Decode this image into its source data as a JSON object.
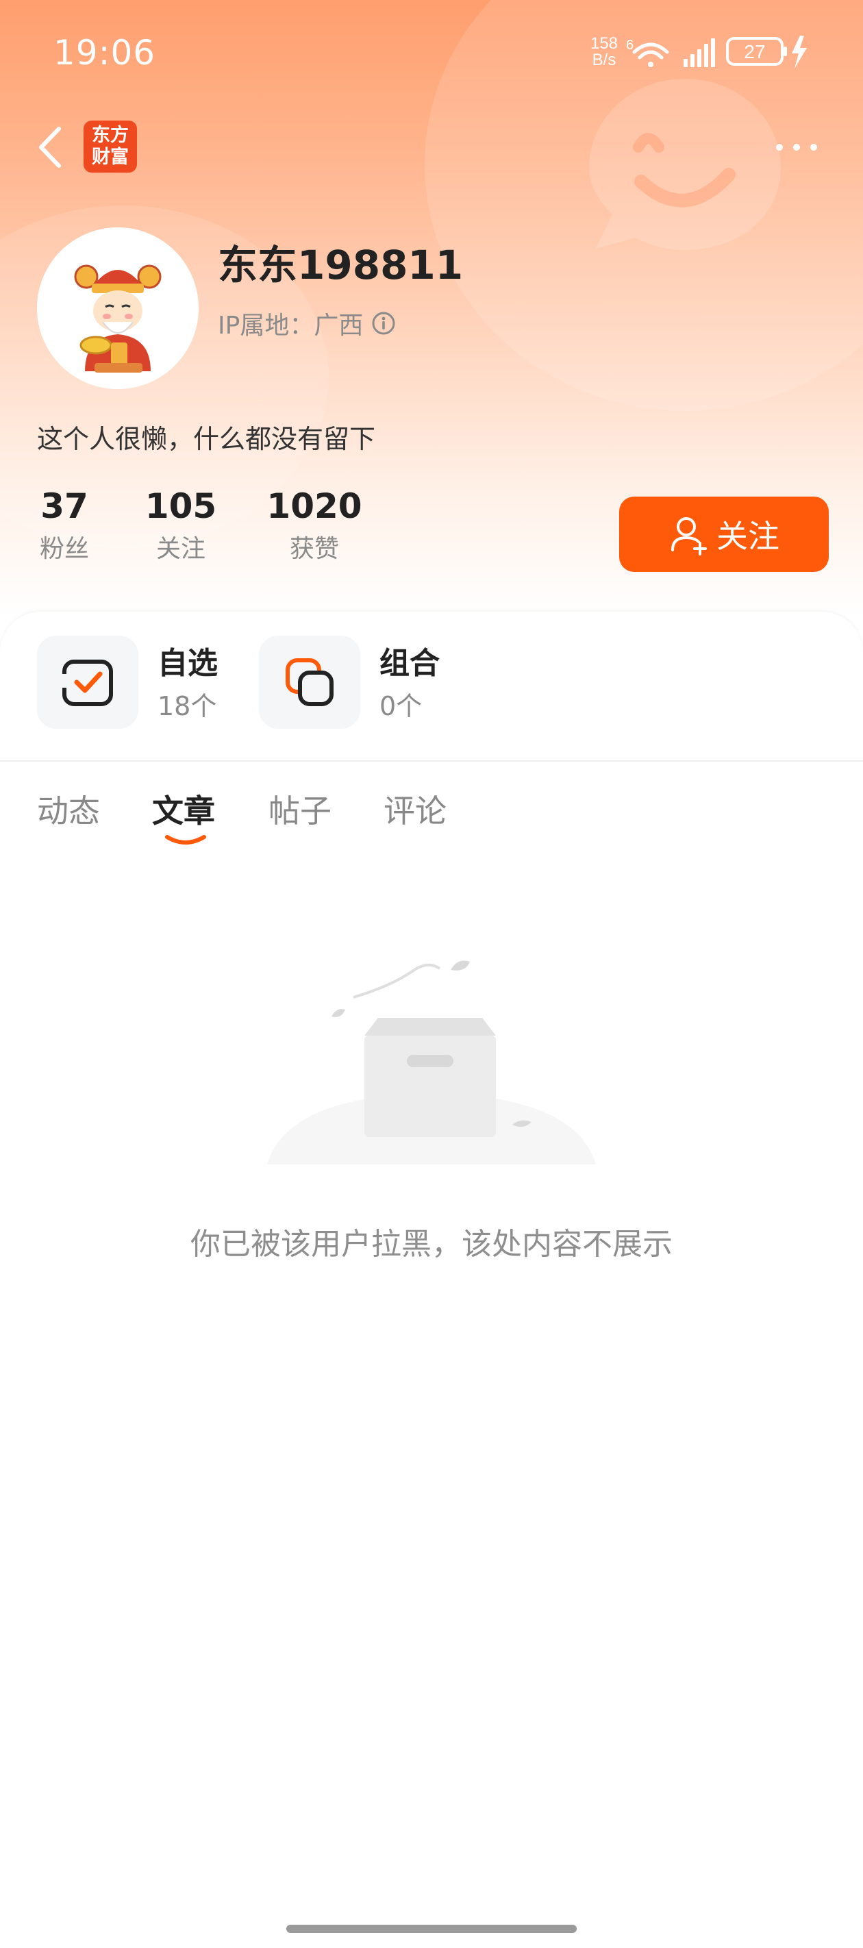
{
  "status_bar": {
    "time": "19:06",
    "net_speed_value": "158",
    "net_speed_unit": "B/s",
    "wifi_badge": "6",
    "battery_level": "27",
    "icons": [
      "wifi-icon",
      "signal-icon",
      "battery-icon",
      "charging-icon"
    ]
  },
  "nav": {
    "back_icon": "chevron-left-icon",
    "logo_line1": "东方",
    "logo_line2": "财富",
    "more_icon": "more-dots-icon"
  },
  "profile": {
    "username": "东东198811",
    "ip_location": "IP属地：广西",
    "bio": "这个人很懒，什么都没有留下",
    "stats": [
      {
        "value": "37",
        "label": "粉丝"
      },
      {
        "value": "105",
        "label": "关注"
      },
      {
        "value": "1020",
        "label": "获赞"
      }
    ],
    "follow_label": "关注"
  },
  "shortcuts": [
    {
      "title": "自选",
      "sub": "18个",
      "icon": "watchlist-check-icon"
    },
    {
      "title": "组合",
      "sub": "0个",
      "icon": "portfolio-stack-icon"
    }
  ],
  "tabs": [
    {
      "label": "动态",
      "active": false
    },
    {
      "label": "文章",
      "active": true
    },
    {
      "label": "帖子",
      "active": false
    },
    {
      "label": "评论",
      "active": false
    }
  ],
  "empty_state": {
    "message": "你已被该用户拉黑，该处内容不展示",
    "icon": "empty-box-icon"
  },
  "colors": {
    "accent": "#ff5a0a",
    "logo": "#ef4a1f",
    "header_top": "#ff9e6e",
    "text_secondary": "#8a8a8a"
  }
}
